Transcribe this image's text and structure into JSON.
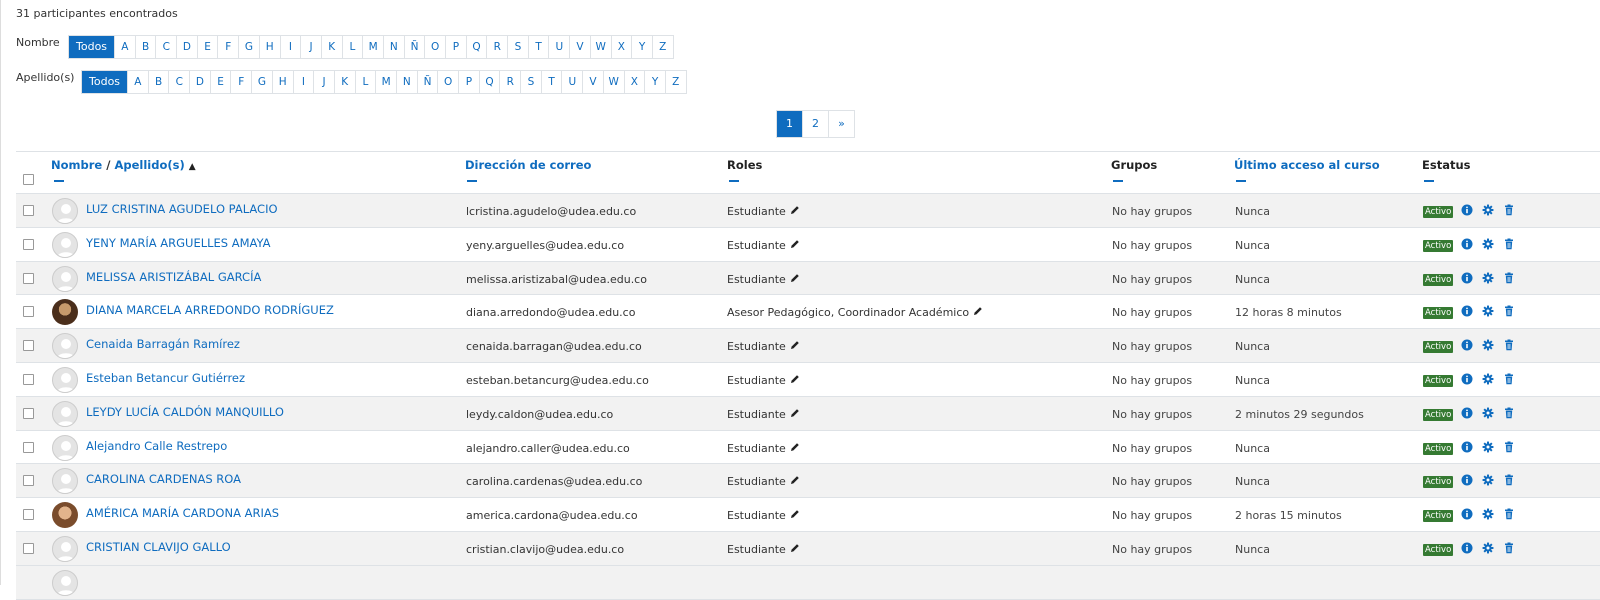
{
  "summary": "31 participantes encontrados",
  "first_name_filter": {
    "label": "Nombre",
    "all": "Todos",
    "letters": [
      "A",
      "B",
      "C",
      "D",
      "E",
      "F",
      "G",
      "H",
      "I",
      "J",
      "K",
      "L",
      "M",
      "N",
      "Ñ",
      "O",
      "P",
      "Q",
      "R",
      "S",
      "T",
      "U",
      "V",
      "W",
      "X",
      "Y",
      "Z"
    ]
  },
  "last_name_filter": {
    "label": "Apellido(s)",
    "all": "Todos",
    "letters": [
      "A",
      "B",
      "C",
      "D",
      "E",
      "F",
      "G",
      "H",
      "I",
      "J",
      "K",
      "L",
      "M",
      "N",
      "Ñ",
      "O",
      "P",
      "Q",
      "R",
      "S",
      "T",
      "U",
      "V",
      "W",
      "X",
      "Y",
      "Z"
    ]
  },
  "pagination": {
    "pages": [
      "1",
      "2"
    ],
    "next": "»",
    "current": "1"
  },
  "columns": {
    "name": "Nombre",
    "sep": "/",
    "surname": "Apellido(s)",
    "email": "Dirección de correo",
    "roles": "Roles",
    "groups": "Grupos",
    "last_access": "Último acceso al curso",
    "status": "Estatus"
  },
  "rows": [
    {
      "name": "LUZ CRISTINA AGUDELO PALACIO",
      "email": "lcristina.agudelo@udea.edu.co",
      "roles": "Estudiante",
      "groups": "No hay grupos",
      "last_access": "Nunca",
      "status": "Activo",
      "avatar": "default"
    },
    {
      "name": "YENY MARÍA ARGUELLES AMAYA",
      "email": "yeny.arguelles@udea.edu.co",
      "roles": "Estudiante",
      "groups": "No hay grupos",
      "last_access": "Nunca",
      "status": "Activo",
      "avatar": "default"
    },
    {
      "name": "MELISSA ARISTIZÁBAL GARCÍA",
      "email": "melissa.aristizabal@udea.edu.co",
      "roles": "Estudiante",
      "groups": "No hay grupos",
      "last_access": "Nunca",
      "status": "Activo",
      "avatar": "default"
    },
    {
      "name": "DIANA MARCELA ARREDONDO RODRÍGUEZ",
      "email": "diana.arredondo@udea.edu.co",
      "roles": "Asesor Pedagógico, Coordinador Académico",
      "groups": "No hay grupos",
      "last_access": "12 horas 8 minutos",
      "status": "Activo",
      "avatar": "photo1"
    },
    {
      "name": "Cenaida Barragán Ramírez",
      "email": "cenaida.barragan@udea.edu.co",
      "roles": "Estudiante",
      "groups": "No hay grupos",
      "last_access": "Nunca",
      "status": "Activo",
      "avatar": "default"
    },
    {
      "name": "Esteban Betancur Gutiérrez",
      "email": "esteban.betancurg@udea.edu.co",
      "roles": "Estudiante",
      "groups": "No hay grupos",
      "last_access": "Nunca",
      "status": "Activo",
      "avatar": "default"
    },
    {
      "name": "LEYDY LUCÍA CALDÓN MANQUILLO",
      "email": "leydy.caldon@udea.edu.co",
      "roles": "Estudiante",
      "groups": "No hay grupos",
      "last_access": "2 minutos 29 segundos",
      "status": "Activo",
      "avatar": "default"
    },
    {
      "name": "Alejandro Calle Restrepo",
      "email": "alejandro.caller@udea.edu.co",
      "roles": "Estudiante",
      "groups": "No hay grupos",
      "last_access": "Nunca",
      "status": "Activo",
      "avatar": "default"
    },
    {
      "name": "CAROLINA CARDENAS ROA",
      "email": "carolina.cardenas@udea.edu.co",
      "roles": "Estudiante",
      "groups": "No hay grupos",
      "last_access": "Nunca",
      "status": "Activo",
      "avatar": "default"
    },
    {
      "name": "AMÉRICA MARÍA CARDONA ARIAS",
      "email": "america.cardona@udea.edu.co",
      "roles": "Estudiante",
      "groups": "No hay grupos",
      "last_access": "2 horas 15 minutos",
      "status": "Activo",
      "avatar": "photo2"
    },
    {
      "name": "CRISTIAN CLAVIJO GALLO",
      "email": "cristian.clavijo@udea.edu.co",
      "roles": "Estudiante",
      "groups": "No hay grupos",
      "last_access": "Nunca",
      "status": "Activo",
      "avatar": "default"
    }
  ],
  "colors": {
    "accent": "#0f6cbf",
    "active_badge": "#357a32"
  },
  "icons": {
    "edit": "pencil-icon",
    "info": "info-icon",
    "settings": "gear-icon",
    "delete": "trash-icon",
    "sort": "sort-asc-icon"
  }
}
